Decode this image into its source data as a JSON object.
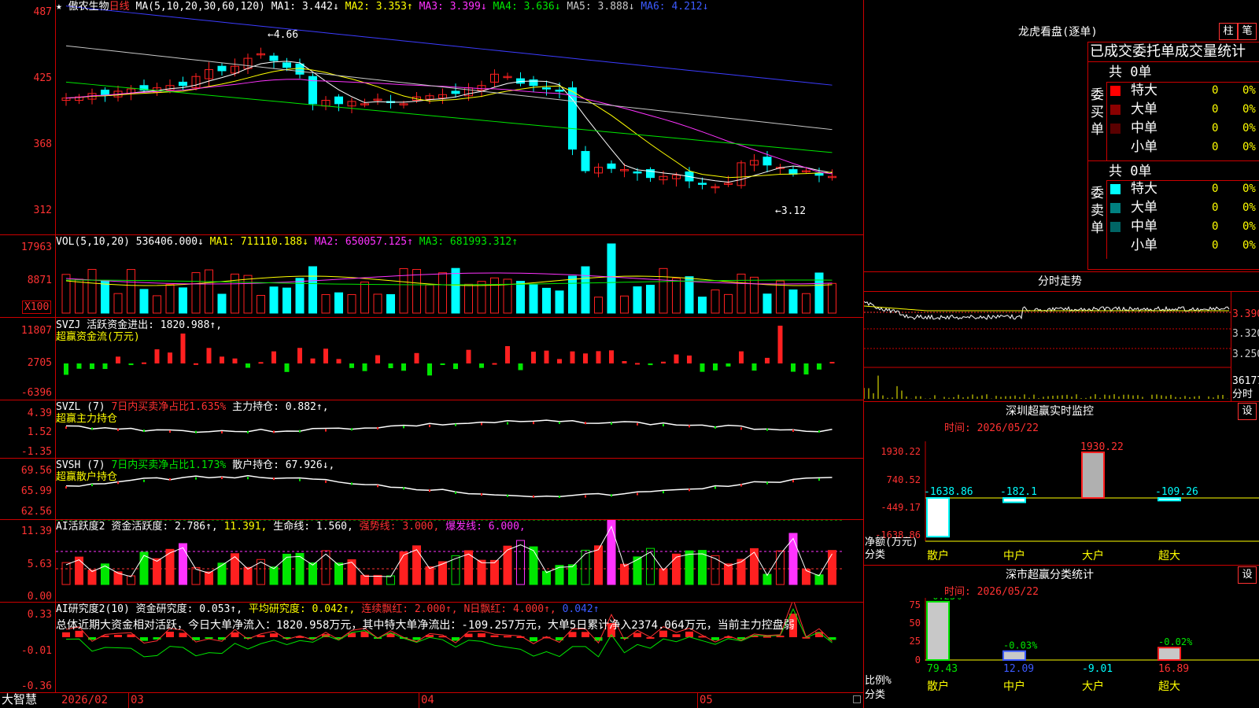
{
  "app": {
    "brand": "大智慧"
  },
  "stock": {
    "star": "★",
    "name": "傲农生物",
    "period": "日线"
  },
  "kline": {
    "ma_title": "MA(5,10,20,30,60,120)",
    "ma1": "MA1: 3.442↓",
    "ma2": "MA2: 3.353↑",
    "ma3": "MA3: 3.399↓",
    "ma4": "MA4: 3.636↓",
    "ma5": "MA5: 3.888↓",
    "ma6": "MA6: 4.212↓",
    "y_ticks": [
      "487",
      "425",
      "368",
      "312"
    ],
    "high_mark": "4.66",
    "low_mark": "3.12",
    "colors": {
      "up": "#ff2020",
      "down": "#00ffff",
      "ma1": "#ffffff",
      "ma2": "#ffff00",
      "ma3": "#ff33ff",
      "ma4": "#00e600",
      "ma5": "#c8c8c8",
      "ma6": "#3c3cff"
    }
  },
  "vol": {
    "title": "VOL(5,10,20)",
    "val": "536406.000↓",
    "ma1": "MA1: 711110.188↓",
    "ma2": "MA2: 650057.125↑",
    "ma3": "MA3: 681993.312↑",
    "y_ticks": [
      "17963",
      "8871"
    ],
    "unit": "X100"
  },
  "svzj": {
    "title": "SVZJ",
    "label": "活跃资金进出: 1820.988↑,",
    "sub": "超赢资金流(万元)",
    "y_ticks": [
      "11807",
      "2705",
      "-6396"
    ]
  },
  "svzl": {
    "title": "SVZL (7)",
    "l1": "7日内买卖净占比1.635%",
    "l2": "主力持仓: 0.882↑,",
    "sub": "超赢主力持仓",
    "y_ticks": [
      "4.39",
      "1.52",
      "-1.35"
    ]
  },
  "svsh": {
    "title": "SVSH (7)",
    "l1": "7日内买卖净占比1.173%",
    "l2": "散户持仓: 67.926↓,",
    "sub": "超赢散户持仓",
    "y_ticks": [
      "69.56",
      "65.99",
      "62.56"
    ]
  },
  "ai1": {
    "title": "AI活跃度2",
    "l1": "资金活跃度: 2.786↑,",
    "l2": "11.391,",
    "l3": "生命线: 1.560,",
    "l4": "强势线: 3.000,",
    "l5": "爆发线: 6.000,",
    "y_ticks": [
      "11.39",
      "5.63",
      "0.00"
    ]
  },
  "ai2": {
    "title": "AI研究度2(10)",
    "l1": "资金研究度: 0.053↑,",
    "l2": "平均研究度: 0.042↑,",
    "l3": "连续飘红: 2.000↑,",
    "l4": "N日飘红: 4.000↑,",
    "l5": "0.042↑",
    "summary": "总体近期大资金相对活跃，今日大单净流入：1820.958万元，其中特大单净流出：-109.257万元，大单5日累计净入2374.064万元，当前主力控盘弱",
    "y_ticks": [
      "0.33",
      "-0.01",
      "-0.36"
    ]
  },
  "xaxis": {
    "labels": [
      "2026/02",
      "03",
      "04",
      "05"
    ]
  },
  "longhu": {
    "title": "龙虎看盘(逐单)",
    "btn1": "柱",
    "btn2": "笔",
    "subtitle": "已成交委托单成交量统计",
    "buy": {
      "side": "委买单",
      "total": "共 0单",
      "rows": [
        {
          "label": "特大",
          "count": "0",
          "pct": "0%",
          "color": "#ff0000"
        },
        {
          "label": "大单",
          "count": "0",
          "pct": "0%",
          "color": "#8b0000"
        },
        {
          "label": "中单",
          "count": "0",
          "pct": "0%",
          "color": "#5a0000"
        },
        {
          "label": "小单",
          "count": "0",
          "pct": "0%",
          "color": "#000000"
        }
      ]
    },
    "sell": {
      "side": "委卖单",
      "total": "共 0单",
      "rows": [
        {
          "label": "特大",
          "count": "0",
          "pct": "0%",
          "color": "#00ffff"
        },
        {
          "label": "大单",
          "count": "0",
          "pct": "0%",
          "color": "#008080"
        },
        {
          "label": "中单",
          "count": "0",
          "pct": "0%",
          "color": "#006464"
        },
        {
          "label": "小单",
          "count": "0",
          "pct": "0%",
          "color": "#000000"
        }
      ]
    }
  },
  "intraday": {
    "title": "分时走势",
    "prices": [
      "3.390",
      "3.320",
      "3.250"
    ],
    "vol": "36177",
    "vol_unit": "分时"
  },
  "monitor": {
    "title": "深圳超赢实时监控",
    "btn": "设",
    "time_label": "时间: 2026/05/22",
    "y_ticks": [
      "1930.22",
      "740.52",
      "-449.17",
      "-1638.86"
    ],
    "axis_label_1": "净额(万元)",
    "axis_label_2": "分类",
    "categories": [
      "散户",
      "中户",
      "大户",
      "超大"
    ],
    "values": [
      -1638.86,
      -182.1,
      1930.22,
      -109.26
    ],
    "value_labels": [
      "-1638.86",
      "-182.1",
      "1930.22",
      "-109.26"
    ]
  },
  "classify": {
    "title": "深市超赢分类统计",
    "btn": "设",
    "time_label": "时间: 2026/05/22",
    "y_ticks": [
      "75",
      "50",
      "25",
      "0"
    ],
    "axis_label_1": "比例%",
    "axis_label_2": "分类",
    "categories": [
      "散户",
      "中户",
      "大户",
      "超大"
    ],
    "pct_values": [
      79.43,
      12.09,
      -9.01,
      16.89
    ],
    "pct_labels": [
      "79.43",
      "12.09",
      "-9.01",
      "16.89"
    ],
    "chg_labels": [
      "-0.23%",
      "-0.03%",
      "",
      "-0.02%"
    ]
  }
}
